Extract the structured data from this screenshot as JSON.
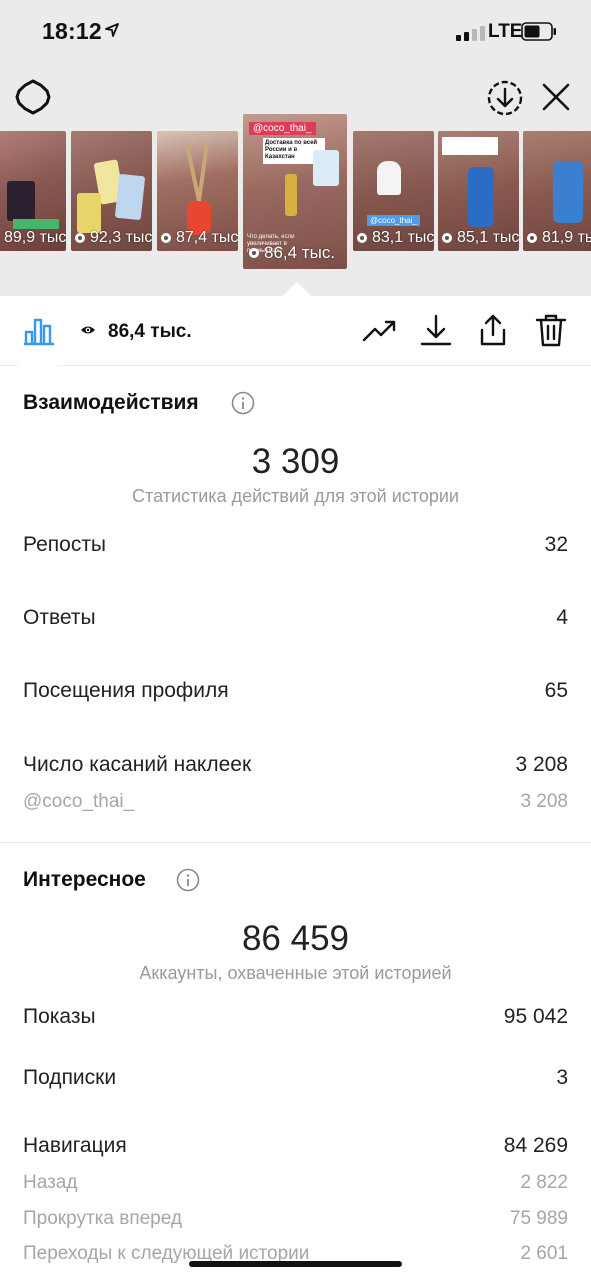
{
  "status_bar": {
    "time": "18:12",
    "network": "LTE"
  },
  "stories": [
    {
      "views": "89,9 тыс."
    },
    {
      "views": "92,3 тыс."
    },
    {
      "views": "87,4 тыс."
    },
    {
      "views": "86,4 тыс.",
      "active": true,
      "tag": "@coco_thai_",
      "headline": "Доставка по всей России и в Казахстан",
      "caption": "Что делать, если увеличивает в подмышках?"
    },
    {
      "views": "83,1 тыс.",
      "tag": "@coco_thai_"
    },
    {
      "views": "85,1 тыс."
    },
    {
      "views": "81,9 тыс."
    }
  ],
  "toolbar": {
    "views": "86,4 тыс."
  },
  "interactions": {
    "title": "Взаимодействия",
    "total": "3 309",
    "subtitle": "Статистика действий для этой истории",
    "rows": [
      {
        "label": "Репосты",
        "value": "32"
      },
      {
        "label": "Ответы",
        "value": "4"
      },
      {
        "label": "Посещения профиля",
        "value": "65"
      },
      {
        "label": "Число касаний наклеек",
        "value": "3 208"
      }
    ],
    "sticker_row": {
      "label": "@coco_thai_",
      "value": "3 208"
    }
  },
  "discovery": {
    "title": "Интересное",
    "total": "86 459",
    "subtitle": "Аккаунты, охваченные этой историей",
    "rows": [
      {
        "label": "Показы",
        "value": "95 042"
      },
      {
        "label": "Подписки",
        "value": "3"
      },
      {
        "label": "Навигация",
        "value": "84 269"
      }
    ],
    "nav_rows": [
      {
        "label": "Назад",
        "value": "2 822"
      },
      {
        "label": "Прокрутка вперед",
        "value": "75 989"
      },
      {
        "label": "Переходы к следующей истории",
        "value": "2 601"
      }
    ]
  },
  "colors": {
    "accent": "#3897f0",
    "muted": "#9a9a9a",
    "top_bg": "#ebebeb"
  }
}
